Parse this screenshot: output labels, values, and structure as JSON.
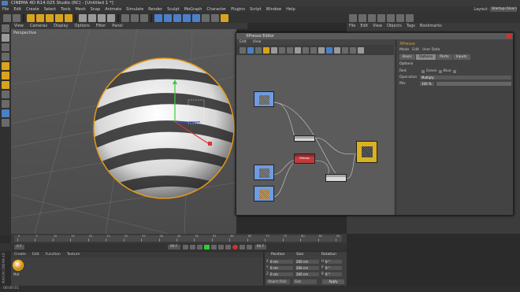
{
  "app": {
    "title": "CINEMA 4D R14.025 Studio (RC) - [Untitled 1 *]",
    "menu": [
      "File",
      "Edit",
      "Create",
      "Select",
      "Tools",
      "Mesh",
      "Snap",
      "Animate",
      "Simulate",
      "Render",
      "Sculpt",
      "MoGraph",
      "Character",
      "Plugins",
      "Script",
      "Window",
      "Help"
    ],
    "layout_label": "Layout:",
    "layout_value": "Startup (User)"
  },
  "viewport": {
    "menu": [
      "View",
      "Cameras",
      "Display",
      "Options",
      "Filter",
      "Panel"
    ],
    "label": "Perspective"
  },
  "object_manager": {
    "menu": [
      "File",
      "Edit",
      "View",
      "Objects",
      "Tags",
      "Bookmarks"
    ]
  },
  "xpresso": {
    "title": "XPresso Editor",
    "menu": [
      "Edit",
      "View"
    ],
    "nodes": {
      "red_label": "Bitmap"
    },
    "attributes": {
      "title": "XPresso",
      "menu": [
        "Mode",
        "Edit",
        "User Data"
      ],
      "tabs": [
        "Basic",
        "Options",
        "Ports",
        "Inputs"
      ],
      "active_tab": "Options",
      "section": "Options",
      "rows": [
        {
          "label": "Red",
          "check_label": "Green",
          "check2": "Blue"
        },
        {
          "label": "Operation",
          "value": "Multiply"
        },
        {
          "label": "Mix",
          "value": "100 %"
        }
      ]
    }
  },
  "timeline": {
    "ticks": [
      "0",
      "5",
      "10",
      "15",
      "20",
      "25",
      "30",
      "35",
      "40",
      "45",
      "50",
      "55",
      "60",
      "65",
      "70",
      "75",
      "80",
      "85",
      "90"
    ],
    "start_frame": "0 F",
    "current_frame": "90 F",
    "end_frame": "90 F"
  },
  "material_manager": {
    "menu": [
      "Create",
      "Edit",
      "Function",
      "Texture"
    ],
    "material_name": "Mat"
  },
  "coordinates": {
    "headers": [
      "Position",
      "Size",
      "Rotation"
    ],
    "rows": [
      {
        "axis": "X",
        "pos": "0 cm",
        "size": "200 cm",
        "rot_axis": "H",
        "rot": "0 °"
      },
      {
        "axis": "Y",
        "pos": "0 cm",
        "size": "200 cm",
        "rot_axis": "P",
        "rot": "0 °"
      },
      {
        "axis": "Z",
        "pos": "0 cm",
        "size": "200 cm",
        "rot_axis": "B",
        "rot": "0 °"
      }
    ],
    "object_mode": "Object (Rel)",
    "size_mode": "Size",
    "apply": "Apply"
  },
  "status": "00:00:01",
  "vertical_logo": "MAXON CINEMA 4D"
}
